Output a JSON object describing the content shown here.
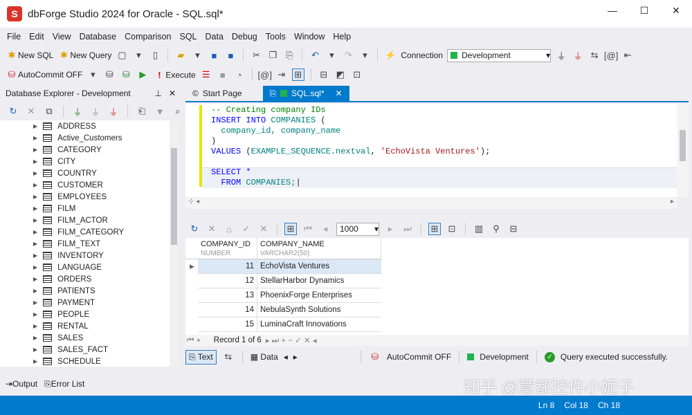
{
  "window": {
    "title": "dbForge Studio 2024 for Oracle - SQL.sql*",
    "logo": "S",
    "minimize": "—",
    "maximize": "☐",
    "close": "✕"
  },
  "menu": [
    "File",
    "Edit",
    "View",
    "Database",
    "Comparison",
    "SQL",
    "Data",
    "Debug",
    "Tools",
    "Window",
    "Help"
  ],
  "toolbar1": {
    "new_sql": "New SQL",
    "new_query": "New Query",
    "connection_label": "Connection",
    "connection_value": "Development"
  },
  "toolbar2": {
    "autocommit": "AutoCommit OFF",
    "execute": "Execute"
  },
  "explorer": {
    "title": "Database Explorer - Development",
    "tables": [
      "ADDRESS",
      "Active_Customers",
      "CATEGORY",
      "CITY",
      "COUNTRY",
      "CUSTOMER",
      "EMPLOYEES",
      "FILM",
      "FILM_ACTOR",
      "FILM_CATEGORY",
      "FILM_TEXT",
      "INVENTORY",
      "LANGUAGE",
      "ORDERS",
      "PATIENTS",
      "PAYMENT",
      "PEOPLE",
      "RENTAL",
      "SALES",
      "SALES_FACT",
      "SCHEDULE"
    ]
  },
  "tabs": {
    "start": "Start Page",
    "sql": "SQL.sql*"
  },
  "code": {
    "comment": "-- Creating company IDs",
    "insert": "INSERT INTO",
    "companies": "COMPANIES",
    "paren_open": " (",
    "cols": "  company_id, company_name",
    "paren_close": ")",
    "values": "VALUES",
    "seq": "EXAMPLE_SEQUENCE.nextval",
    "str": "'EchoVista Ventures'",
    "end": ");",
    "select": "SELECT *",
    "from": "  FROM",
    "companies2": "COMPANIES;"
  },
  "grid": {
    "page_size": "1000",
    "columns": [
      {
        "name": "COMPANY_ID",
        "type": "NUMBER"
      },
      {
        "name": "COMPANY_NAME",
        "type": "VARCHAR2(50)"
      }
    ],
    "rows": [
      [
        "11",
        "EchoVista Ventures"
      ],
      [
        "12",
        "StellarHarbor Dynamics"
      ],
      [
        "13",
        "PhoenixForge Enterprises"
      ],
      [
        "14",
        "NebulaSynth Solutions"
      ],
      [
        "15",
        "LuminaCraft Innovations"
      ]
    ],
    "record": "Record 1 of 6"
  },
  "bottombar": {
    "text": "Text",
    "data": "Data",
    "autocommit": "AutoCommit OFF",
    "connection": "Development",
    "message": "Query executed successfully."
  },
  "panels": {
    "output": "Output",
    "errors": "Error List"
  },
  "status": {
    "ln": "Ln 8",
    "col": "Col 18",
    "ch": "Ch 18"
  },
  "watermark": "知乎 @慧都控件小妮子",
  "colors": {
    "accent": "#007acc",
    "success": "#22b24c",
    "brand": "#d9342b"
  }
}
